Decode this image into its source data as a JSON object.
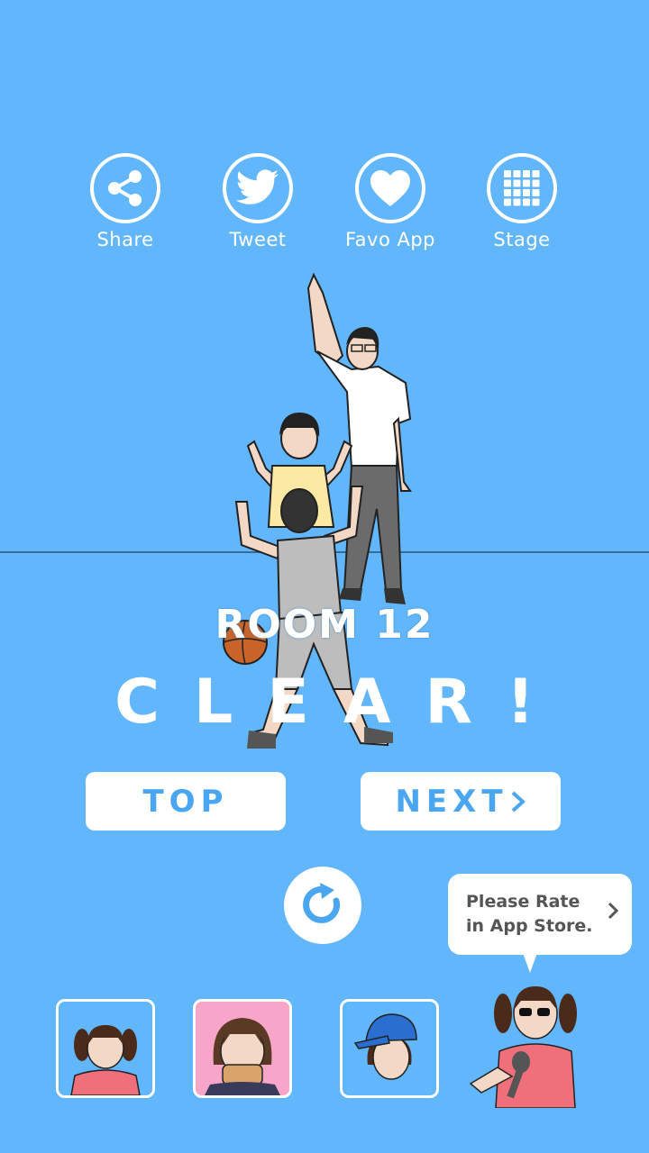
{
  "toolbar": {
    "share_label": "Share",
    "tweet_label": "Tweet",
    "favo_label": "Favo App",
    "stage_label": "Stage"
  },
  "result": {
    "room_label": "ROOM 12",
    "clear_label": "CLEAR!"
  },
  "buttons": {
    "top_label": "TOP",
    "next_label": "NEXT"
  },
  "rate_bubble": {
    "line1": "Please Rate",
    "line2": "in App Store."
  },
  "colors": {
    "background": "#62b6fb",
    "button_text": "#4aa6f0",
    "thumb_pink": "#f7a6c9"
  },
  "icons": [
    "share-icon",
    "twitter-bird-icon",
    "heart-icon",
    "grid-icon",
    "refresh-icon",
    "chevron-right-icon"
  ]
}
